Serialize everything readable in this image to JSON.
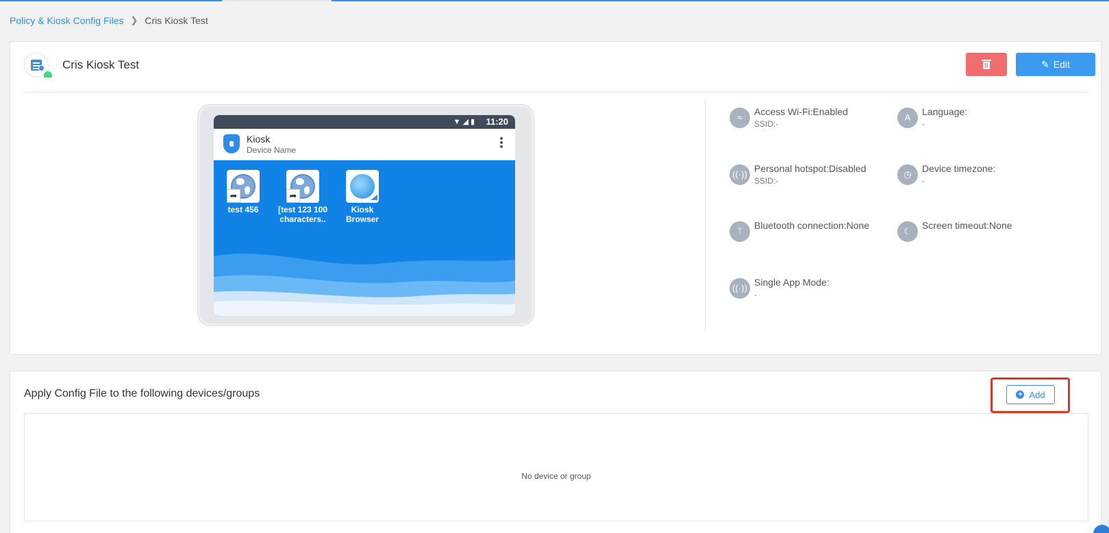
{
  "breadcrumb": {
    "parent": "Policy & Kiosk Config Files",
    "current": "Cris Kiosk Test"
  },
  "header": {
    "title": "Cris Kiosk Test",
    "edit_label": "Edit"
  },
  "preview": {
    "status_time": "11:20",
    "status_icons": "▼◢▮",
    "app_name": "Kiosk",
    "device_name": "Device Name",
    "apps": [
      {
        "label": "test 456"
      },
      {
        "label_line1": "[test 123 100",
        "label_line2": "characters.."
      },
      {
        "label_line1": "Kiosk",
        "label_line2": "Browser"
      }
    ]
  },
  "settings": {
    "wifi": {
      "title": "Access Wi-Fi:Enabled",
      "sub": "SSID:-"
    },
    "language": {
      "title": "Language:",
      "sub": "-"
    },
    "hotspot": {
      "title": "Personal hotspot:Disabled",
      "sub": "SSID:-"
    },
    "timezone": {
      "title": "Device timezone:",
      "sub": "-"
    },
    "bluetooth": {
      "title": "Bluetooth connection:None"
    },
    "screen_timeout": {
      "title": "Screen timeout:None"
    },
    "single_app": {
      "title": "Single App Mode:",
      "sub": "-"
    }
  },
  "apply_section": {
    "title": "Apply Config File to the following devices/groups",
    "add_label": "Add",
    "empty_text": "No device or group"
  },
  "colors": {
    "accent": "#3a8ee6",
    "delete": "#f26d6d",
    "highlight": "#d93a28"
  }
}
